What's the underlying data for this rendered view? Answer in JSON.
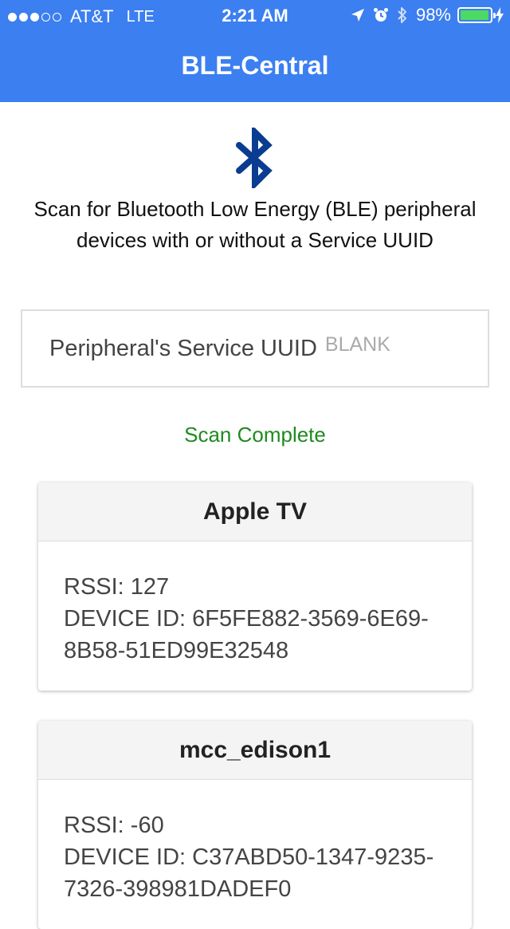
{
  "status_bar": {
    "carrier": "AT&T",
    "network": "LTE",
    "time": "2:21 AM",
    "battery_percent": "98%",
    "battery_level": 0.98,
    "signal_bars_filled": 3,
    "signal_bars_total": 5,
    "icons": [
      "location-arrow-icon",
      "alarm-clock-icon",
      "bluetooth-icon",
      "battery-icon",
      "charging-bolt-icon"
    ]
  },
  "header": {
    "title": "BLE-Central",
    "background_color": "#3b7ff0"
  },
  "hero": {
    "icon": "bluetooth-icon",
    "icon_color": "#0a3d91",
    "description": "Scan for Bluetooth Low Energy (BLE) peripheral devices with or without a Service UUID"
  },
  "uuid_field": {
    "label": "Peripheral's Service UUID",
    "placeholder": "BLANK",
    "value": ""
  },
  "scan": {
    "status_text": "Scan Complete",
    "status_color": "#1f8a1f"
  },
  "devices": [
    {
      "name": "Apple TV",
      "rssi_text": "RSSI: 127",
      "device_id_text": "DEVICE ID: 6F5FE882-3569-6E69-8B58-51ED99E32548"
    },
    {
      "name": "mcc_edison1",
      "rssi_text": "RSSI: -60",
      "device_id_text": "DEVICE ID: C37ABD50-1347-9235-7326-398981DADEF0"
    }
  ]
}
